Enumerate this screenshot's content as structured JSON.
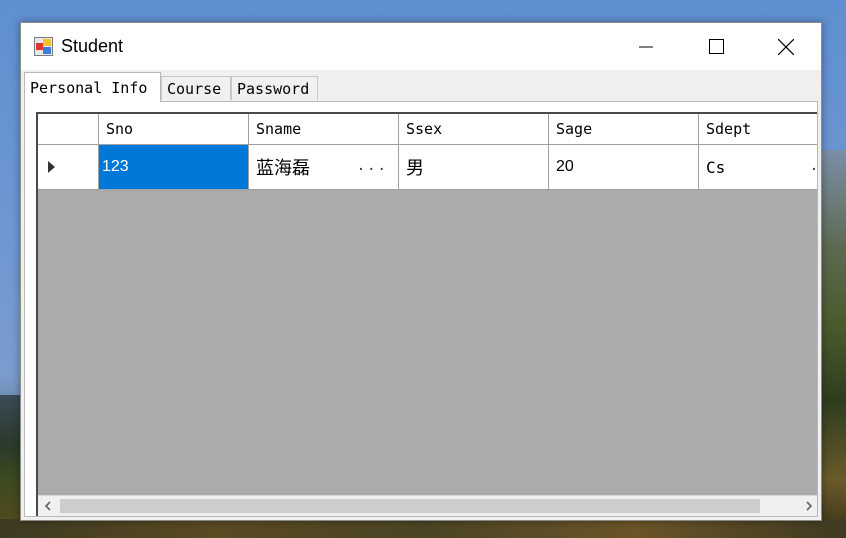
{
  "window": {
    "title": "Student"
  },
  "titlebar": {
    "minimize_icon": "minimize-icon",
    "maximize_icon": "maximize-icon",
    "close_icon": "close-icon"
  },
  "tabs": [
    {
      "label": "Personal Info",
      "active": true
    },
    {
      "label": "Course",
      "active": false
    },
    {
      "label": "Password",
      "active": false
    }
  ],
  "grid": {
    "columns": [
      "Sno",
      "Sname",
      "Ssex",
      "Sage",
      "Sdept"
    ],
    "rows": [
      {
        "Sno": "123",
        "Sname": "蓝海磊",
        "Ssex": "男",
        "Sage": "20",
        "Sdept": "Cs"
      }
    ],
    "selected_cell": "Sno",
    "current_row_icon": "row-pointer-icon",
    "ellipsis": "...",
    "edge_ellipsis": "."
  },
  "colors": {
    "selection": "#0078d7",
    "grid_background": "#ababab",
    "window_background": "#f0f0f0"
  }
}
